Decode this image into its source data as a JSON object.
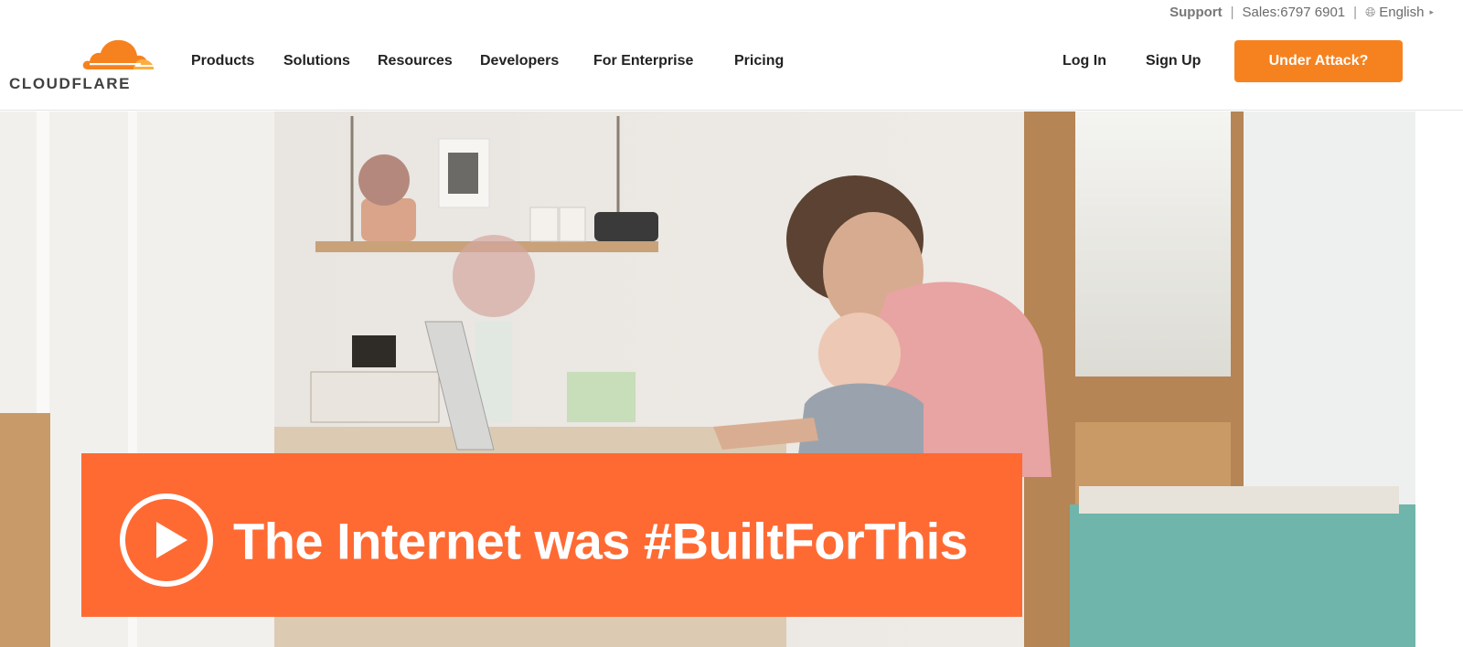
{
  "utility_bar": {
    "support_label": "Support",
    "separator": "|",
    "sales_label": "Sales:6797 6901",
    "language_label": "English"
  },
  "header": {
    "brand": "CLOUDFLARE",
    "nav_items": [
      {
        "label": "Products"
      },
      {
        "label": "Solutions"
      },
      {
        "label": "Resources"
      },
      {
        "label": "Developers"
      },
      {
        "label": "For Enterprise"
      },
      {
        "label": "Pricing"
      }
    ],
    "login_label": "Log In",
    "signup_label": "Sign Up",
    "cta_label": "Under Attack?"
  },
  "hero": {
    "headline": "The Internet was #BuiltForThis"
  },
  "colors": {
    "brand_orange": "#f6821f",
    "banner_orange": "#ff6a33"
  },
  "icons": {
    "logo": "cloud-logo-icon",
    "language": "globe-icon",
    "video": "play-icon"
  }
}
